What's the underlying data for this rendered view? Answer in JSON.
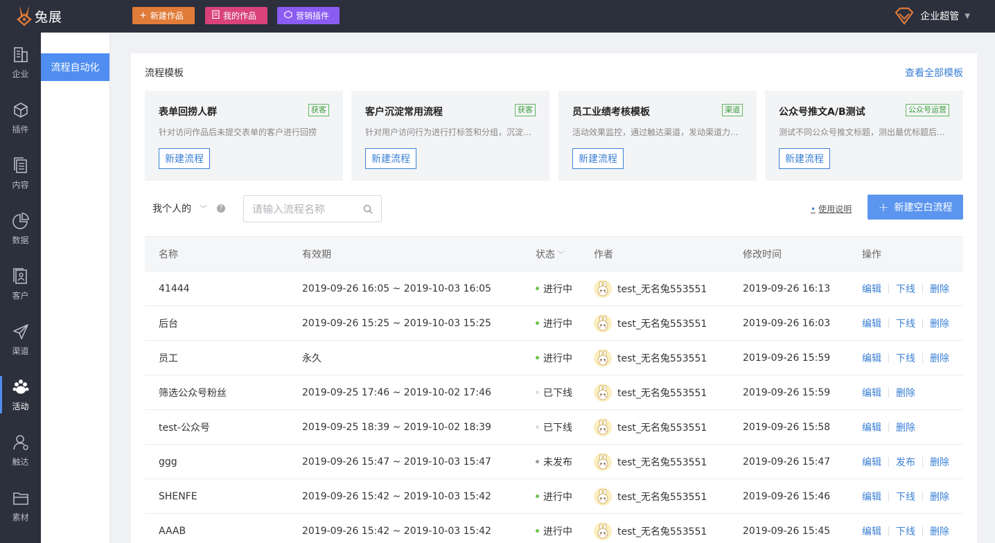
{
  "app": {
    "brand": "兔展"
  },
  "topbar": {
    "buttons": [
      {
        "label": "新建作品",
        "icon": "plus-icon"
      },
      {
        "label": "我的作品",
        "icon": "document-icon"
      },
      {
        "label": "营销插件",
        "icon": "cube-icon"
      }
    ],
    "user": "企业超管"
  },
  "sidebar": {
    "items": [
      {
        "label": "企业",
        "icon": "building-icon"
      },
      {
        "label": "插件",
        "icon": "cube-icon"
      },
      {
        "label": "内容",
        "icon": "files-icon"
      },
      {
        "label": "数据",
        "icon": "pie-chart-icon"
      },
      {
        "label": "客户",
        "icon": "contact-icon"
      },
      {
        "label": "渠道",
        "icon": "paper-plane-icon"
      },
      {
        "label": "活动",
        "icon": "paw-icon",
        "active": true
      },
      {
        "label": "触达",
        "icon": "user-icon"
      },
      {
        "label": "素材",
        "icon": "folder-icon"
      }
    ]
  },
  "subsidebar": {
    "active": "流程自动化"
  },
  "templates": {
    "title": "流程模板",
    "view_all": "查看全部模板",
    "items": [
      {
        "name": "表单回捞人群",
        "tag": "获客",
        "desc": "针对访问作品后未提交表单的客户进行回捞",
        "button": "新建流程"
      },
      {
        "name": "客户沉淀常用流程",
        "tag": "获客",
        "desc": "针对用户访问行为进行打标签和分组，沉淀...",
        "button": "新建流程"
      },
      {
        "name": "员工业绩考核模板",
        "tag": "渠道",
        "desc": "活动效果监控，通过触达渠道，发动渠道力...",
        "button": "新建流程"
      },
      {
        "name": "公众号推文A/B测试",
        "tag": "公众号运营",
        "desc": "测试不同公众号推文标题，测出最优标题后...",
        "button": "新建流程"
      }
    ]
  },
  "filter": {
    "scope": "我个人的",
    "search_placeholder": "请输入流程名称",
    "usage": "使用说明",
    "new_blank": "新建空白流程"
  },
  "table": {
    "headers": {
      "name": "名称",
      "valid": "有效期",
      "status": "状态",
      "author": "作者",
      "modified": "修改时间",
      "ops": "操作"
    },
    "rows": [
      {
        "name": "41444",
        "valid": "2019-09-26 16:05 ~ 2019-10-03 16:05",
        "status": "进行中",
        "status_color": "#6cc04a",
        "author": "test_无名兔553551",
        "modified": "2019-09-26 16:13",
        "ops": [
          "编辑",
          "下线",
          "删除"
        ]
      },
      {
        "name": "后台",
        "valid": "2019-09-26 15:25 ~ 2019-10-03 15:25",
        "status": "进行中",
        "status_color": "#6cc04a",
        "author": "test_无名兔553551",
        "modified": "2019-09-26 16:03",
        "ops": [
          "编辑",
          "下线",
          "删除"
        ]
      },
      {
        "name": "员工",
        "valid": "永久",
        "status": "进行中",
        "status_color": "#6cc04a",
        "author": "test_无名兔553551",
        "modified": "2019-09-26 15:59",
        "ops": [
          "编辑",
          "下线",
          "删除"
        ]
      },
      {
        "name": "筛选公众号粉丝",
        "valid": "2019-09-25 17:46 ~ 2019-10-02 17:46",
        "status": "已下线",
        "status_color": "#dddddd",
        "author": "test_无名兔553551",
        "modified": "2019-09-26 15:59",
        "ops": [
          "编辑",
          "删除"
        ]
      },
      {
        "name": "test-公众号",
        "valid": "2019-09-25 18:39 ~ 2019-10-02 18:39",
        "status": "已下线",
        "status_color": "#dddddd",
        "author": "test_无名兔553551",
        "modified": "2019-09-26 15:58",
        "ops": [
          "编辑",
          "删除"
        ]
      },
      {
        "name": "ggg",
        "valid": "2019-09-26 15:47 ~ 2019-10-03 15:47",
        "status": "未发布",
        "status_color": "#999999",
        "author": "test_无名兔553551",
        "modified": "2019-09-26 15:47",
        "ops": [
          "编辑",
          "发布",
          "删除"
        ]
      },
      {
        "name": "SHENFE",
        "valid": "2019-09-26 15:42 ~ 2019-10-03 15:42",
        "status": "进行中",
        "status_color": "#6cc04a",
        "author": "test_无名兔553551",
        "modified": "2019-09-26 15:46",
        "ops": [
          "编辑",
          "下线",
          "删除"
        ]
      },
      {
        "name": "AAAB",
        "valid": "2019-09-26 15:42 ~ 2019-10-03 15:42",
        "status": "进行中",
        "status_color": "#6cc04a",
        "author": "test_无名兔553551",
        "modified": "2019-09-26 15:45",
        "ops": [
          "编辑",
          "下线",
          "删除"
        ]
      }
    ]
  }
}
